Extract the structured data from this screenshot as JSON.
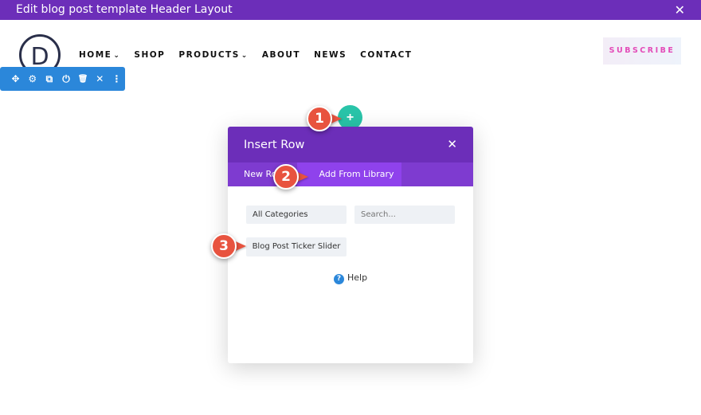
{
  "window": {
    "title": "Edit blog post template Header Layout",
    "close_icon": "close-icon",
    "bar_color": "#6c2eb9"
  },
  "header": {
    "logo_letter": "D",
    "nav": [
      {
        "label": "HOME",
        "has_dropdown": true
      },
      {
        "label": "SHOP",
        "has_dropdown": false
      },
      {
        "label": "PRODUCTS",
        "has_dropdown": true
      },
      {
        "label": "ABOUT",
        "has_dropdown": false
      },
      {
        "label": "NEWS",
        "has_dropdown": false
      },
      {
        "label": "CONTACT",
        "has_dropdown": false
      }
    ],
    "dropdown_glyph": "⌄",
    "subscribe_label": "SUBSCRIBE"
  },
  "toolbar": {
    "color": "#2b87da",
    "icons": [
      "move-icon",
      "settings-icon",
      "duplicate-icon",
      "power-icon",
      "trash-icon",
      "close-icon",
      "more-icon"
    ],
    "glyphs": [
      "✥",
      "⚙",
      "⧉",
      "⏻",
      "🗑",
      "✕",
      "⋮"
    ]
  },
  "add_button": {
    "glyph": "+",
    "color": "#29c4a9"
  },
  "modal": {
    "title": "Insert Row",
    "close_glyph": "✕",
    "tabs": {
      "new_row": "New Row",
      "add_from_library": "Add From Library"
    },
    "category_select": "All Categories",
    "search_placeholder": "Search...",
    "library_item": "Blog Post Ticker Slider",
    "help_label": "Help",
    "help_glyph": "?"
  },
  "callouts": [
    "1",
    "2",
    "3"
  ],
  "accent_colors": {
    "purple": "#6c2eb9",
    "tab_purple": "#7e3bd0",
    "active_tab": "#8f42ec",
    "callout_red": "#e8533f",
    "subscribe_pink": "#e34bb8"
  }
}
